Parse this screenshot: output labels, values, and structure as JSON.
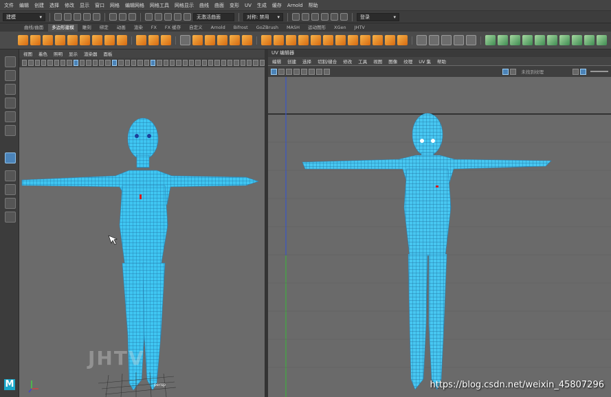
{
  "menubar": {
    "items": [
      "文件",
      "编辑",
      "创建",
      "选择",
      "修改",
      "显示",
      "窗口",
      "网格",
      "编辑网格",
      "网格工具",
      "网格显示",
      "曲线",
      "曲面",
      "变形",
      "UV",
      "生成",
      "缓存",
      "Arnold",
      "帮助"
    ]
  },
  "statusline": {
    "mode_dropdown": "建模",
    "workspace_field": "无激活曲面",
    "symmetry_dropdown": "对称: 禁用",
    "login_dropdown": "登录"
  },
  "shelf_tabs": {
    "items": [
      "曲线/曲面",
      "多边形建模",
      "雕刻",
      "绑定",
      "动画",
      "渲染",
      "FX",
      "FX 缓存",
      "自定义",
      "Arnold",
      "Bifrost",
      "GoZBrush",
      "MASH",
      "运动图形",
      "XGen",
      "JHTV"
    ],
    "active_index": 1
  },
  "left_panel": {
    "menu": [
      "视图",
      "着色",
      "照明",
      "显示",
      "渲染器",
      "面板"
    ],
    "camera_label": "persp"
  },
  "right_panel": {
    "title": "UV 编辑器",
    "menu": [
      "编辑",
      "创建",
      "选择",
      "切割/缝合",
      "修改",
      "工具",
      "视图",
      "图像",
      "纹理",
      "UV 集",
      "帮助"
    ],
    "texture_label": "未找到纹理"
  },
  "watermark": "https://blog.csdn.net/weixin_45807296",
  "logo_text": "JHTV",
  "colors": {
    "mesh": "#3fc6f2",
    "accent": "#4b83b8",
    "background": "#6b6b6b"
  }
}
